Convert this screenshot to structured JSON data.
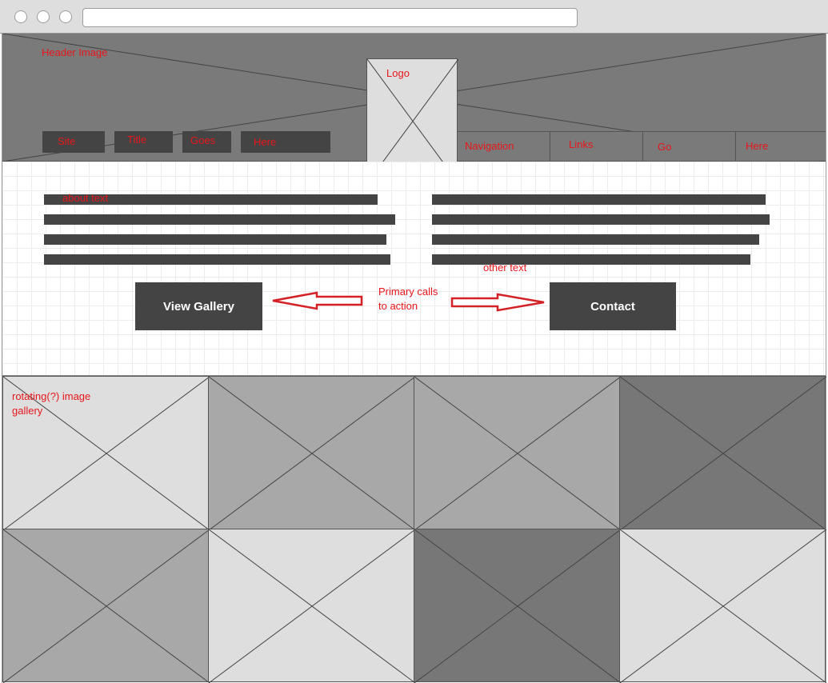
{
  "header": {
    "note": "Header Image",
    "logo_label": "Logo",
    "site_title": [
      "Site",
      "Title",
      "Goes",
      "Here"
    ],
    "navigation": [
      "Navigation",
      "Links",
      "Go",
      "Here"
    ]
  },
  "content": {
    "about_note": "about text",
    "other_note": "other text",
    "cta_note_line1": "Primary calls",
    "cta_note_line2": "to action",
    "view_gallery_label": "View Gallery",
    "contact_label": "Contact"
  },
  "gallery": {
    "note_line1": "rotating(?) image",
    "note_line2": "gallery"
  },
  "colors": {
    "annotation": "#e8161b",
    "dark_fill": "#444444",
    "header_gray": "#7a7a7a",
    "tile_light": "#dedede",
    "tile_mid": "#a8a8a8",
    "tile_dark": "#777777"
  },
  "icons": [
    "image-placeholder-icon",
    "left-arrow-icon",
    "right-arrow-icon"
  ]
}
